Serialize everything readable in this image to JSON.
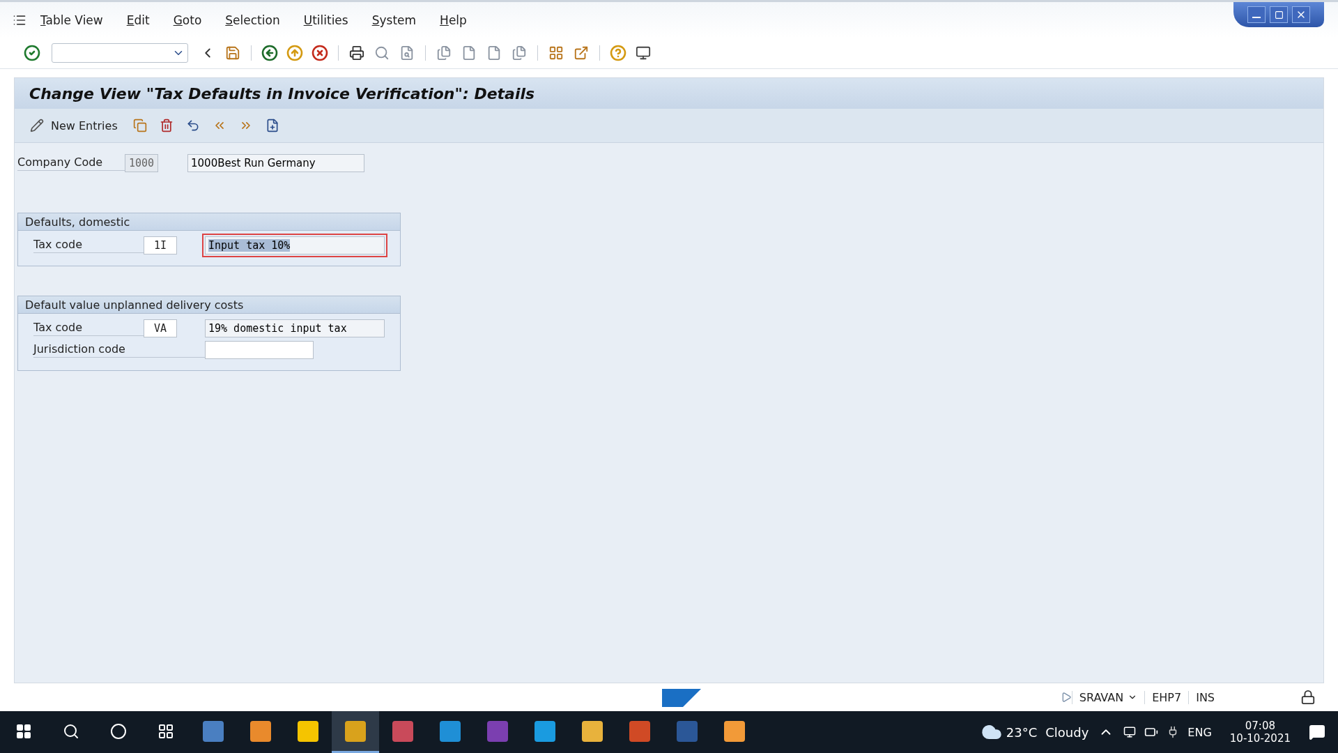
{
  "menu": [
    "Table View",
    "Edit",
    "Goto",
    "Selection",
    "Utilities",
    "System",
    "Help"
  ],
  "title": "Change View \"Tax Defaults in Invoice Verification\": Details",
  "app_toolbar": {
    "new_entries": "New Entries"
  },
  "company_code": {
    "label": "Company Code",
    "code": "1000",
    "readonly": true,
    "name": "1000Best Run Germany"
  },
  "groups": [
    {
      "title": "Defaults, domestic",
      "fields": [
        {
          "kind": "code",
          "label": "Tax code",
          "code": "1I",
          "description": "Input tax 10%",
          "focused": true
        }
      ]
    },
    {
      "title": "Default value unplanned delivery costs",
      "fields": [
        {
          "kind": "code",
          "label": "Tax code",
          "code": "VA",
          "description": "19% domestic input tax",
          "focused": false
        },
        {
          "kind": "input",
          "label": "Jurisdiction code"
        }
      ]
    }
  ],
  "status_bar": {
    "user": "SRAVAN",
    "system": "EHP7",
    "mode": "INS"
  },
  "taskbar": {
    "apps": [
      {
        "color": "#4a7fc1",
        "selected": false
      },
      {
        "color": "#e98a2c",
        "selected": false
      },
      {
        "color": "#f5c400",
        "selected": false
      },
      {
        "color": "#d9a21c",
        "selected": true
      },
      {
        "color": "#c94a5a",
        "selected": false
      },
      {
        "color": "#1f8fd6",
        "selected": false
      },
      {
        "color": "#7b3fb0",
        "selected": false
      },
      {
        "color": "#1a9be0",
        "selected": false
      },
      {
        "color": "#e8b23c",
        "selected": false
      },
      {
        "color": "#d04a25",
        "selected": false
      },
      {
        "color": "#2b5797",
        "selected": false
      },
      {
        "color": "#f29a38",
        "selected": false
      }
    ],
    "weather": {
      "temperature": "23°C",
      "condition": "Cloudy"
    },
    "language": "ENG",
    "time": "07:08",
    "date": "10-10-2021"
  }
}
